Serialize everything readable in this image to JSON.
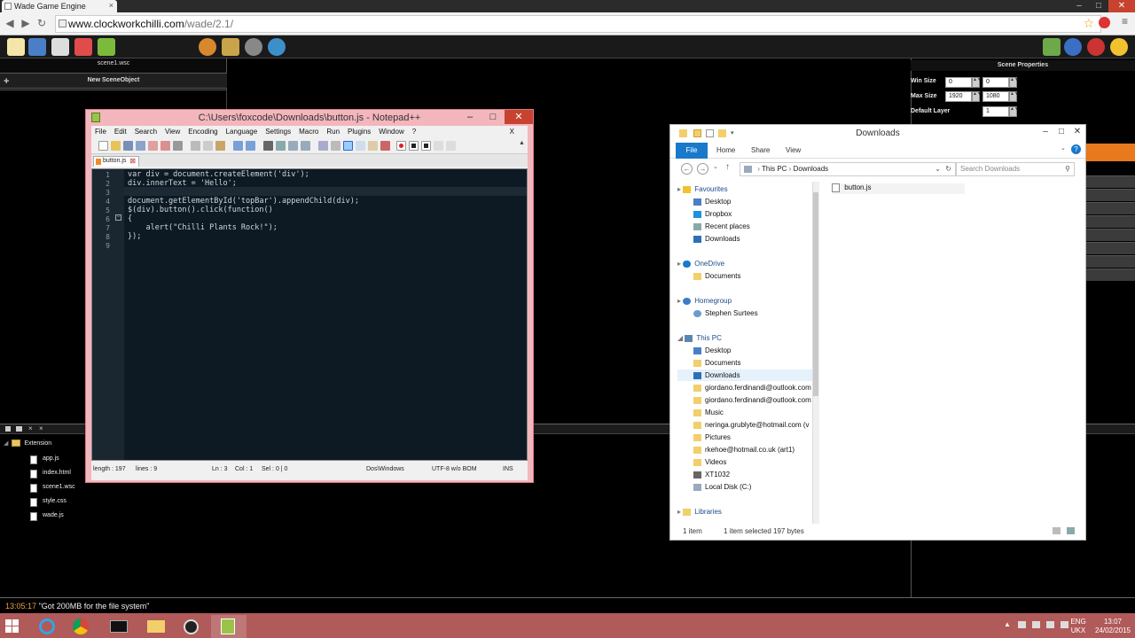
{
  "browser": {
    "tab_title": "Wade Game Engine",
    "url_host": "www.clockworkchilli.com",
    "url_path": "/wade/2.1/"
  },
  "wade": {
    "scene_file": "scene1.wsc",
    "new_scene_object": "New SceneObject",
    "scene_properties_title": "Scene Properties",
    "props": {
      "win_size_label": "Win Size",
      "win_size_w": "0",
      "win_size_h": "0",
      "max_size_label": "Max Size",
      "max_size_w": "1920",
      "max_size_h": "1080",
      "default_layer_label": "Default Layer",
      "default_layer": "1"
    },
    "tree_root": "Extension",
    "tree_files": [
      "app.js",
      "index.html",
      "scene1.wsc",
      "style.css",
      "wade.js"
    ],
    "status_time": "13:05:17",
    "status_msg": "\"Got 200MB for the file system\""
  },
  "notepad": {
    "title": "C:\\Users\\foxcode\\Downloads\\button.js - Notepad++",
    "menu": [
      "File",
      "Edit",
      "Search",
      "View",
      "Encoding",
      "Language",
      "Settings",
      "Macro",
      "Run",
      "Plugins",
      "Window",
      "?"
    ],
    "menu_close": "X",
    "tab": "button.js",
    "line_numbers": [
      "1",
      "2",
      "3",
      "4",
      "5",
      "6",
      "7",
      "8",
      "9"
    ],
    "code_lines": [
      "var div = document.createElement('div');",
      "div.innerText = 'Hello';",
      "",
      "document.getElementById('topBar').appendChild(div);",
      "$(div).button().click(function()",
      "{",
      "    alert(\"Chilli Plants Rock!\");",
      "});",
      ""
    ],
    "status": {
      "length": "length : 197",
      "lines": "lines : 9",
      "ln": "Ln : 3",
      "col": "Col : 1",
      "sel": "Sel : 0 | 0",
      "eol": "Dos\\Windows",
      "encoding": "UTF-8 w/o BOM",
      "mode": "INS"
    }
  },
  "explorer": {
    "title": "Downloads",
    "ribbon_file": "File",
    "ribbon_tabs": [
      "Home",
      "Share",
      "View"
    ],
    "address_parts": [
      "This PC",
      "Downloads"
    ],
    "search_placeholder": "Search Downloads",
    "nav": {
      "favourites": "Favourites",
      "fav_items": [
        "Desktop",
        "Dropbox",
        "Recent places",
        "Downloads"
      ],
      "onedrive": "OneDrive",
      "onedrive_items": [
        "Documents"
      ],
      "homegroup": "Homegroup",
      "homegroup_items": [
        "Stephen Surtees"
      ],
      "thispc": "This PC",
      "thispc_items": [
        "Desktop",
        "Documents",
        "Downloads",
        "giordano.ferdinandi@outlook.com",
        "giordano.ferdinandi@outlook.com",
        "Music",
        "neringa.grublyte@hotmail.com (v",
        "Pictures",
        "rkehoe@hotmail.co.uk (art1)",
        "Videos",
        "XT1032",
        "Local Disk (C:)"
      ],
      "libraries": "Libraries"
    },
    "file": "button.js",
    "status_count": "1 item",
    "status_selected": "1 item selected  197 bytes"
  },
  "taskbar": {
    "lang": "ENG",
    "locale": "UKX",
    "time": "13:07",
    "date": "24/02/2015"
  }
}
